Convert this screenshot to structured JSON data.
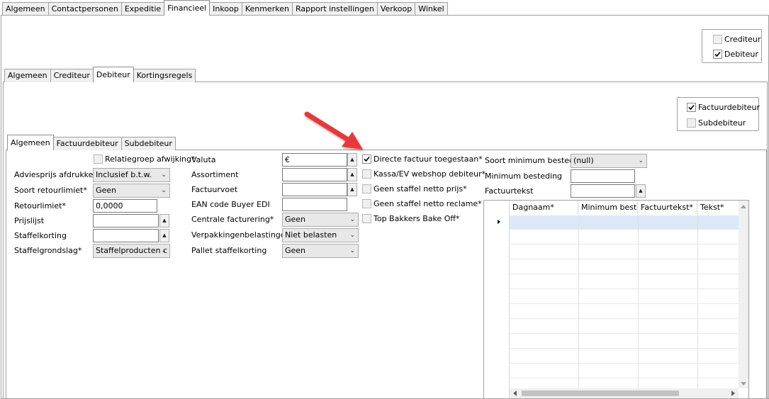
{
  "top_tabs": [
    "Algemeen",
    "Contactpersonen",
    "Expeditie",
    "Financieel",
    "Inkoop",
    "Kenmerken",
    "Rapport instellingen",
    "Verkoop",
    "Winkel"
  ],
  "top_active": "Financieel",
  "type_box": {
    "crediteur": "Crediteur",
    "debiteur": "Debiteur",
    "crediteur_checked": false,
    "debiteur_checked": true
  },
  "sub_tabs": [
    "Algemeen",
    "Crediteur",
    "Debiteur",
    "Kortingsregels"
  ],
  "sub_active": "Debiteur",
  "debtor_box": {
    "factuurdebiteur": "Factuurdebiteur",
    "subdebiteur": "Subdebiteur",
    "factuur_checked": true,
    "sub_checked": false
  },
  "inner_tabs": [
    "Algemeen",
    "Factuurdebiteur",
    "Subdebiteur"
  ],
  "inner_active": "Algemeen",
  "col1": {
    "relatiegroep": "Relatiegroep afwijking*",
    "adviesprijs_label": "Adviesprijs afdrukken*",
    "adviesprijs_value": "Inclusief b.t.w.",
    "retourlimiet_soort_label": "Soort retourlimiet*",
    "retourlimiet_soort_value": "Geen",
    "retourlimiet_label": "Retourlimiet*",
    "retourlimiet_value": "0,0000",
    "prijslijst_label": "Prijslijst",
    "prijslijst_value": "",
    "staffelkorting_label": "Staffelkorting",
    "staffelkorting_value": "",
    "staffelgrondslag_label": "Staffelgrondslag*",
    "staffelgrondslag_value": "Staffelproducten c"
  },
  "col2": {
    "valuta_label": "Valuta",
    "valuta_value": "€",
    "assortiment_label": "Assortiment",
    "assortiment_value": "",
    "factuurvoet_label": "Factuurvoet",
    "factuurvoet_value": "",
    "ean_label": "EAN code Buyer EDI",
    "ean_value": "",
    "centrale_label": "Centrale facturering*",
    "centrale_value": "Geen",
    "verpakking_label": "Verpakkingenbelastingen*",
    "verpakking_value": "Niet belasten",
    "pallet_label": "Pallet staffelkorting",
    "pallet_value": "Geen"
  },
  "col3": [
    {
      "label": "Directe factuur toegestaan*",
      "checked": true,
      "enabled": true
    },
    {
      "label": "Kassa/EV webshop debiteur*",
      "checked": false,
      "enabled": false
    },
    {
      "label": "Geen staffel netto prijs*",
      "checked": false,
      "enabled": false
    },
    {
      "label": "Geen staffel netto reclame*",
      "checked": false,
      "enabled": false
    },
    {
      "label": "Top Bakkers Bake Off*",
      "checked": false,
      "enabled": false
    }
  ],
  "col4": {
    "soort_min_label": "Soort minimum besteding",
    "soort_min_value": "(null)",
    "min_label": "Minimum besteding",
    "min_value": "",
    "factuurtekst_label": "Factuurtekst",
    "factuurtekst_value": ""
  },
  "grid": {
    "columns": [
      "Dagnaam*",
      "Minimum beste...",
      "Factuurtekst*",
      "Tekst*"
    ]
  },
  "colors": {
    "arrow": "#e8393a",
    "row_selected": "#dce8f8",
    "combo_bg": "#e8e8e8"
  }
}
